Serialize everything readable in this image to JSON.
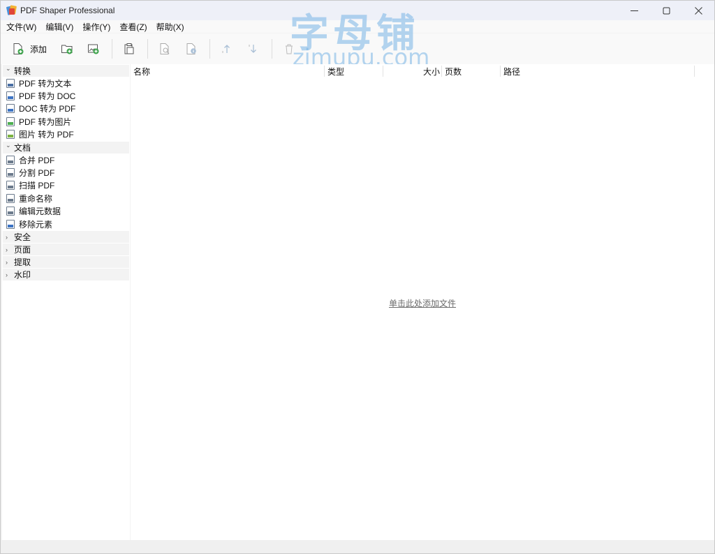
{
  "window": {
    "title": "PDF Shaper Professional"
  },
  "watermark": {
    "chinese": "字母铺",
    "domain": "zimupu.com"
  },
  "menu": [
    {
      "label": "文件(W)"
    },
    {
      "label": "编辑(V)"
    },
    {
      "label": "操作(Y)"
    },
    {
      "label": "查看(Z)"
    },
    {
      "label": "帮助(X)"
    }
  ],
  "toolbar": {
    "add_label": "添加"
  },
  "sidebar": {
    "groups": [
      {
        "label": "转换",
        "expanded": true,
        "items": [
          {
            "label": "PDF 转为文本",
            "color": "#4a6fa5"
          },
          {
            "label": "PDF 转为 DOC",
            "color": "#3b73c4"
          },
          {
            "label": "DOC 转为 PDF",
            "color": "#3b73c4"
          },
          {
            "label": "PDF 转为图片",
            "color": "#4caf50"
          },
          {
            "label": "图片 转为 PDF",
            "color": "#7cb342"
          }
        ]
      },
      {
        "label": "文档",
        "expanded": true,
        "items": [
          {
            "label": "合并 PDF",
            "color": "#6b7a8c"
          },
          {
            "label": "分割 PDF",
            "color": "#6b7a8c"
          },
          {
            "label": "扫描 PDF",
            "color": "#6b7a8c"
          },
          {
            "label": "重命名称",
            "color": "#6b7a8c"
          },
          {
            "label": "编辑元数据",
            "color": "#6b7a8c"
          },
          {
            "label": "移除元素",
            "color": "#3b73c4"
          }
        ]
      },
      {
        "label": "安全",
        "expanded": false,
        "items": []
      },
      {
        "label": "页面",
        "expanded": false,
        "items": []
      },
      {
        "label": "提取",
        "expanded": false,
        "items": []
      },
      {
        "label": "水印",
        "expanded": false,
        "items": []
      }
    ]
  },
  "file_list": {
    "columns": [
      {
        "label": "名称"
      },
      {
        "label": "类型"
      },
      {
        "label": "大小"
      },
      {
        "label": "页数"
      },
      {
        "label": "路径"
      }
    ],
    "empty_text": "单击此处添加文件"
  },
  "colors": {
    "accent_green": "#3fa34d",
    "icon_blue": "#4a90d9"
  }
}
